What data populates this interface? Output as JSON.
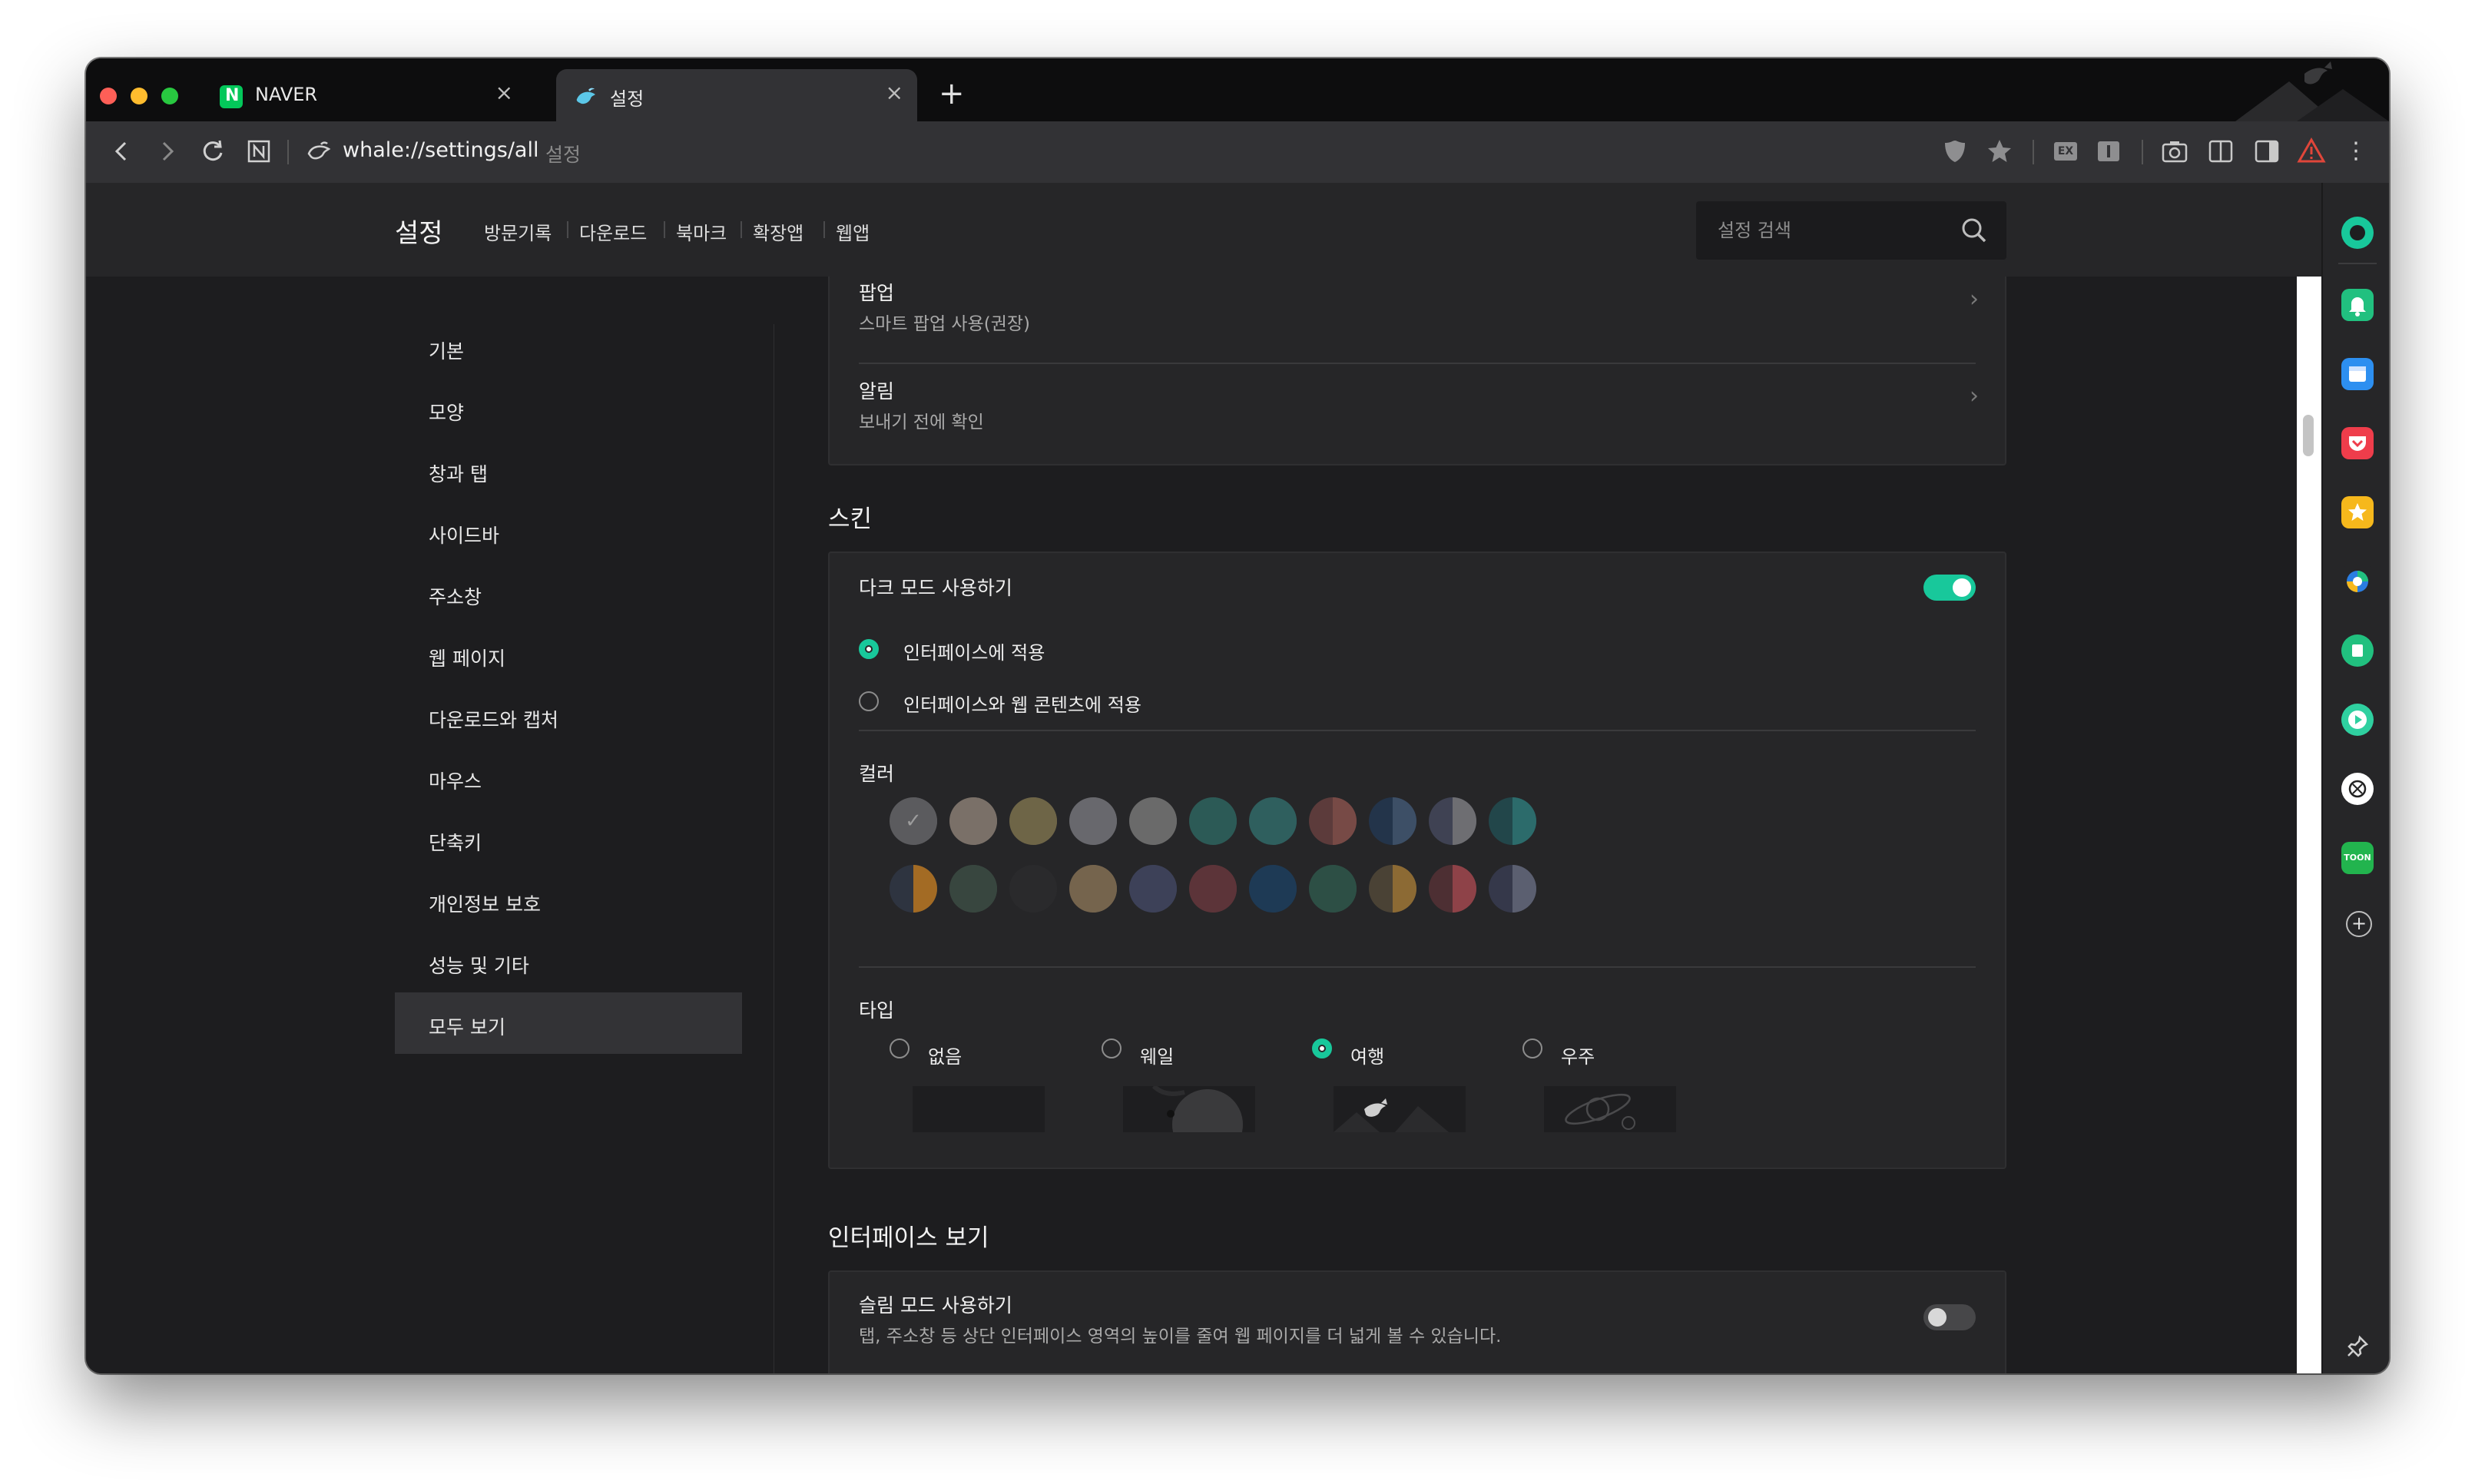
{
  "tabs": [
    {
      "title": "NAVER",
      "favicon": "naver-icon",
      "favicon_letter": "N",
      "close": "×"
    },
    {
      "title": "설정",
      "favicon": "whale-icon",
      "close": "×"
    }
  ],
  "new_tab": "+",
  "toolbar": {
    "url": "whale://settings/all",
    "url_hint": "설정",
    "icons": [
      "back-icon",
      "forward-icon",
      "reload-icon",
      "naver-home-icon",
      "whale-site-icon",
      "shield-icon",
      "star-icon",
      "ex-icon",
      "translate-icon",
      "screenshot-icon",
      "split-view-icon",
      "sidebar-toggle-icon",
      "warning-icon",
      "more-icon"
    ],
    "ex_label": "EX",
    "more": "⋮"
  },
  "header": {
    "title": "설정",
    "nav": [
      "방문기록",
      "다운로드",
      "북마크",
      "확장앱",
      "웹앱"
    ],
    "search_placeholder": "설정 검색"
  },
  "sidenav": {
    "items": [
      "기본",
      "모양",
      "창과 탭",
      "사이드바",
      "주소창",
      "웹 페이지",
      "다운로드와 캡처",
      "마우스",
      "단축키",
      "개인정보 보호",
      "성능 및 기타",
      "모두 보기"
    ],
    "active": "모두 보기"
  },
  "content": {
    "popup": {
      "title": "팝업",
      "subtitle": "스마트 팝업 사용(권장)",
      "chevron": "›"
    },
    "alert": {
      "title": "알림",
      "subtitle": "보내기 전에 확인",
      "chevron": "›"
    },
    "skin": {
      "section_title": "스킨",
      "dark_mode_label": "다크 모드 사용하기",
      "dark_mode_on": true,
      "options": [
        {
          "label": "인터페이스에 적용",
          "selected": true
        },
        {
          "label": "인터페이스와 웹 콘텐츠에 적용",
          "selected": false
        }
      ],
      "color_label": "컬러",
      "check": "✓",
      "colors_row1": [
        {
          "left": "#5b5b5e",
          "right": "#5b5b5e",
          "selected": true
        },
        {
          "left": "#7a7068",
          "right": "#7a7068"
        },
        {
          "left": "#6e6547",
          "right": "#6e6547"
        },
        {
          "left": "#68686d",
          "right": "#68686d"
        },
        {
          "left": "#6a6a6a",
          "right": "#6a6a6a"
        },
        {
          "left": "#2c5a56",
          "right": "#2c5a56"
        },
        {
          "left": "#2f5f5e",
          "right": "#2f5f5e"
        },
        {
          "left": "#5c3b3b",
          "right": "#774a46"
        },
        {
          "left": "#23344a",
          "right": "#3d4f66"
        },
        {
          "left": "#3f4253",
          "right": "#6e6e72"
        },
        {
          "left": "#22464a",
          "right": "#2c6b6b"
        }
      ],
      "colors_row2": [
        {
          "left": "#2e3440",
          "right": "#a36b24"
        },
        {
          "left": "#38463f",
          "right": "#38463f"
        },
        {
          "left": "#2a2a2c",
          "right": "#2a2a2c"
        },
        {
          "left": "#75644d",
          "right": "#75644d"
        },
        {
          "left": "#3d4158",
          "right": "#3d4158"
        },
        {
          "left": "#5c3439",
          "right": "#5c3439"
        },
        {
          "left": "#1e3a55",
          "right": "#1e3a55"
        },
        {
          "left": "#2d4f45",
          "right": "#2d4f45"
        },
        {
          "left": "#4a4235",
          "right": "#8c6a34"
        },
        {
          "left": "#4d2f33",
          "right": "#8e4248"
        },
        {
          "left": "#35384a",
          "right": "#5b5f70"
        }
      ],
      "type_label": "타입",
      "types": [
        {
          "label": "없음",
          "selected": false
        },
        {
          "label": "웨일",
          "selected": false
        },
        {
          "label": "여행",
          "selected": true
        },
        {
          "label": "우주",
          "selected": false
        }
      ]
    },
    "interface": {
      "section_title": "인터페이스 보기",
      "slim_title": "슬림 모드 사용하기",
      "slim_subtitle": "탭, 주소창 등 상단 인터페이스 영역의 높이를 줄여 웹 페이지를 더 넓게 볼 수 있습니다.",
      "slim_on": false
    }
  },
  "sidebar": {
    "icons": [
      "whale-status-icon",
      "notification-icon",
      "calendar-icon",
      "pocket-icon",
      "bookmark-star-icon",
      "translate-app-icon",
      "memo-icon",
      "media-play-icon",
      "openai-icon",
      "webtoon-icon",
      "add-icon",
      "pin-icon"
    ],
    "add": "+",
    "webtoon_text": "TOON"
  },
  "colors": {
    "accent": "#18c89b",
    "naver": "#03c75a",
    "warning": "#e0463a"
  }
}
